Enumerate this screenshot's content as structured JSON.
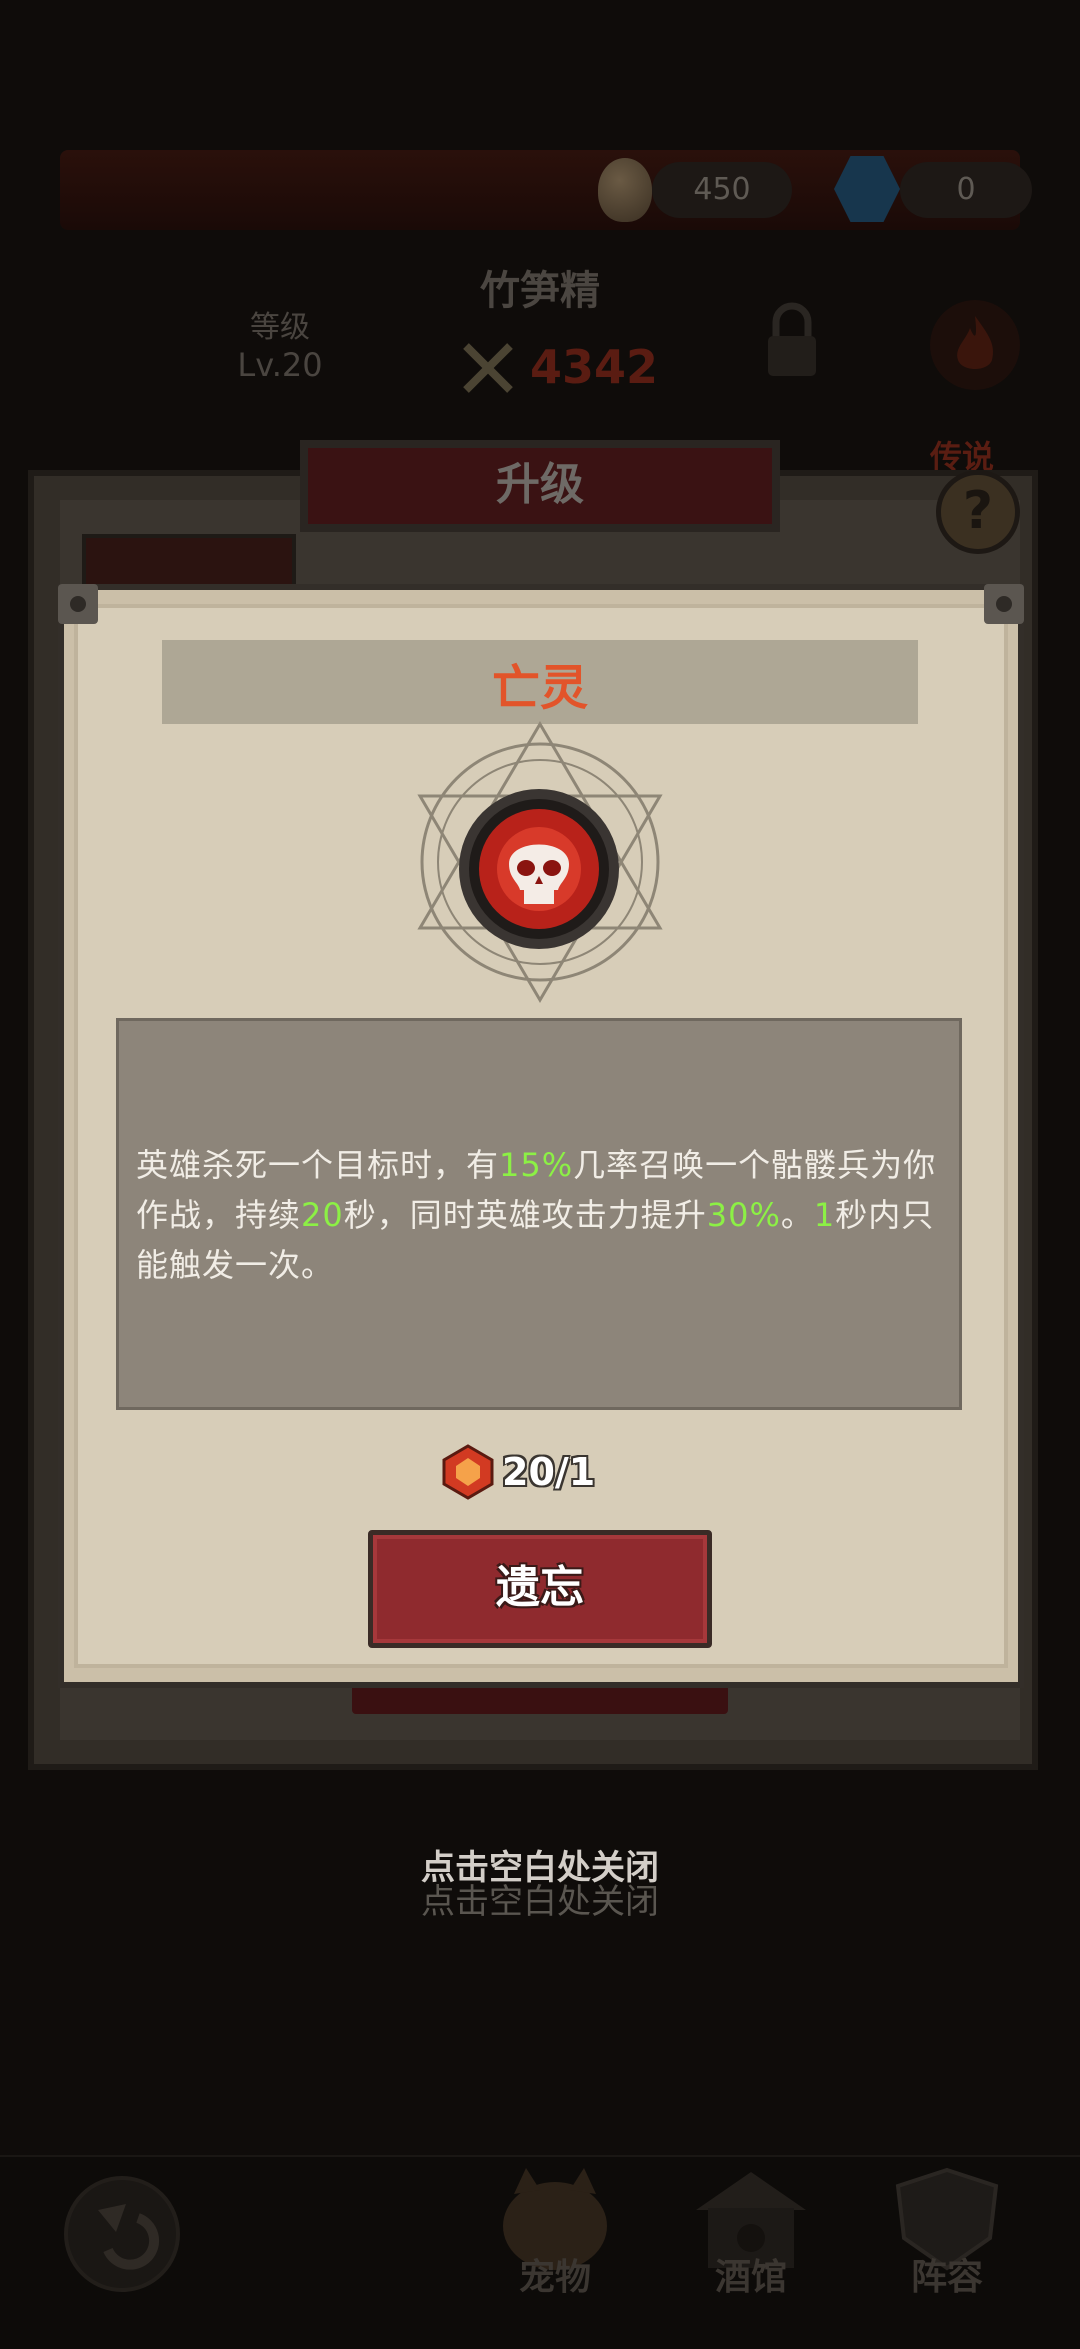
{
  "resources": {
    "eggs": "450",
    "gems": "0"
  },
  "hero": {
    "name": "竹笋精",
    "level_label": "等级",
    "level_value": "Lv.20",
    "power": "4342",
    "rarity": "传说"
  },
  "upgrade_panel": {
    "title": "升级",
    "help_symbol": "?"
  },
  "skill_modal": {
    "title": "亡灵",
    "description_parts": {
      "p1": "英雄杀死一个目标时，有",
      "v1": "15%",
      "p2": "几率召唤一个骷髅兵为你作战，持续",
      "v2": "20",
      "p3": "秒，同时英雄攻击力提升",
      "v3": "30%",
      "p4": "。",
      "v4": "1",
      "p5": "秒内只能触发一次。"
    },
    "highlight_color": "#8cf045",
    "cost": "20/1",
    "forget_button": "遗忘"
  },
  "close_hint": "点击空白处关闭",
  "bottom_nav": {
    "pet": "宠物",
    "tavern": "酒馆",
    "lineup": "阵容"
  },
  "colors": {
    "title_orange": "#e2542a",
    "button_red": "#8f2a2e",
    "parchment": "#d7cdb8"
  }
}
